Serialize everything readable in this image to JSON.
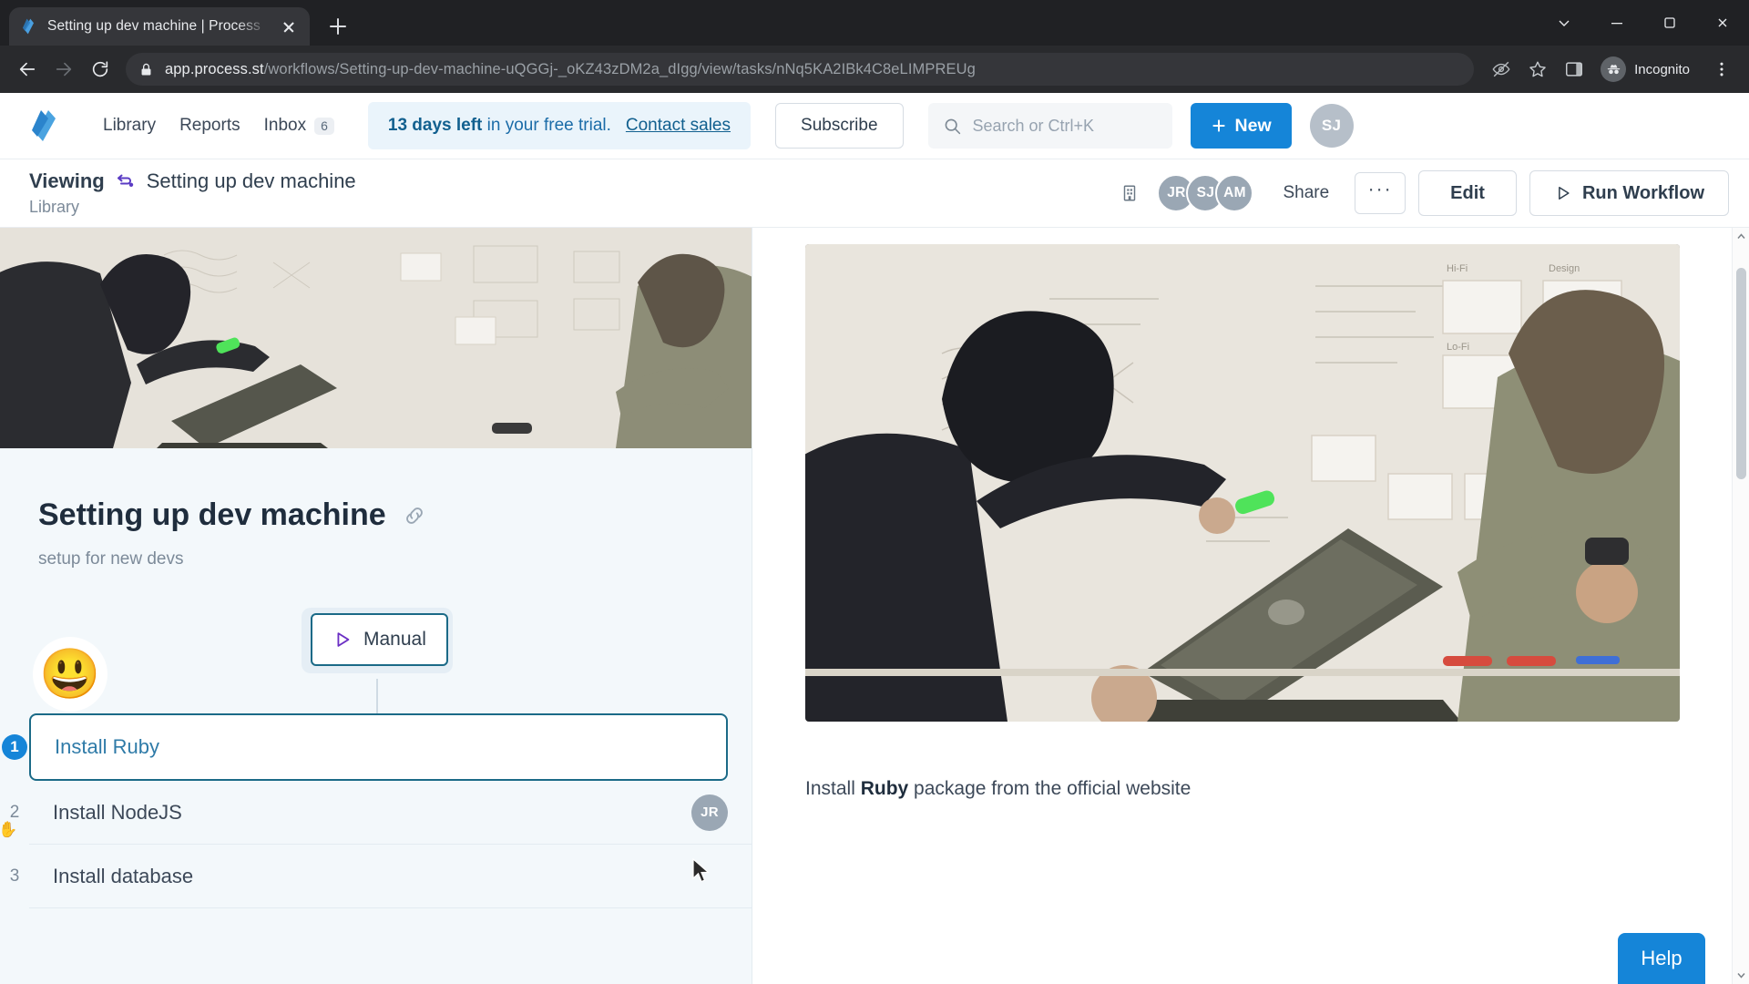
{
  "browser": {
    "tab": {
      "title": "Setting up dev machine | Process",
      "favicon_icon": "process-street-favicon",
      "close_icon": "close-icon"
    },
    "new_tab_icon": "plus-icon",
    "window_controls": {
      "minimize_to_tray_icon": "chevron-down-icon",
      "minimize_icon": "minimize-icon",
      "maximize_icon": "maximize-icon",
      "close_icon": "close-icon"
    },
    "toolbar": {
      "back_icon": "back-arrow-icon",
      "forward_icon": "forward-arrow-icon",
      "reload_icon": "reload-icon",
      "lock_icon": "lock-icon",
      "url_domain": "app.process.st",
      "url_path": "/workflows/Setting-up-dev-machine-uQGGj-_oKZ43zDM2a_dIgg/view/tasks/nNq5KA2IBk4C8eLIMPREUg",
      "third_party_cookie_icon": "eye-blocked-icon",
      "bookmark_icon": "star-icon",
      "side_panel_icon": "side-panel-icon",
      "incognito_icon": "incognito-icon",
      "incognito_label": "Incognito",
      "menu_icon": "kebab-menu-icon"
    }
  },
  "app_header": {
    "logo_icon": "process-street-logo",
    "nav": [
      {
        "label": "Library",
        "name": "nav-library"
      },
      {
        "label": "Reports",
        "name": "nav-reports"
      },
      {
        "label": "Inbox",
        "name": "nav-inbox",
        "badge": "6"
      }
    ],
    "trial": {
      "days_bold": "13 days left",
      "rest": " in your free trial.",
      "contact_sales": "Contact sales"
    },
    "subscribe_label": "Subscribe",
    "search": {
      "icon": "search-icon",
      "placeholder": "Search or Ctrl+K"
    },
    "new_button": {
      "label": "New",
      "icon": "plus-icon"
    },
    "user_avatar": {
      "initials": "SJ"
    }
  },
  "sub_header": {
    "viewing_label": "Viewing",
    "workflow_icon": "workflow-icon",
    "workflow_name": "Setting up dev machine",
    "breadcrumb_parent": "Library",
    "org_icon": "organization-icon",
    "members": [
      {
        "initials": "JR"
      },
      {
        "initials": "SJ"
      },
      {
        "initials": "AM"
      }
    ],
    "share_label": "Share",
    "more_label": "···",
    "edit_label": "Edit",
    "run_label": "Run Workflow",
    "run_icon": "play-icon"
  },
  "workflow": {
    "emoji": "😃",
    "title": "Setting up dev machine",
    "link_icon": "link-icon",
    "description": "setup for new devs",
    "trigger": {
      "label": "Manual",
      "icon": "play-icon"
    },
    "tasks": [
      {
        "number": "1",
        "name": "Install Ruby",
        "active": true,
        "assignee": ""
      },
      {
        "number": "2",
        "name": "Install NodeJS",
        "active": false,
        "assignee": "JR"
      },
      {
        "number": "3",
        "name": "Install database",
        "active": false,
        "assignee": ""
      }
    ]
  },
  "task_detail": {
    "description_pre": "Install ",
    "description_bold": "Ruby",
    "description_post": " package from the official website"
  },
  "help_button": {
    "label": "Help"
  },
  "colors": {
    "accent_blue": "#1585d8",
    "trial_banner_bg": "#eaf4fb",
    "trial_text": "#1b6ca8",
    "left_pane_bg": "#f3f8fb",
    "active_task_border": "#1b6a87",
    "trigger_purple": "#6b2fc4",
    "workflow_icon_purple": "#5b3cc4",
    "help_blue": "#1585d8"
  }
}
